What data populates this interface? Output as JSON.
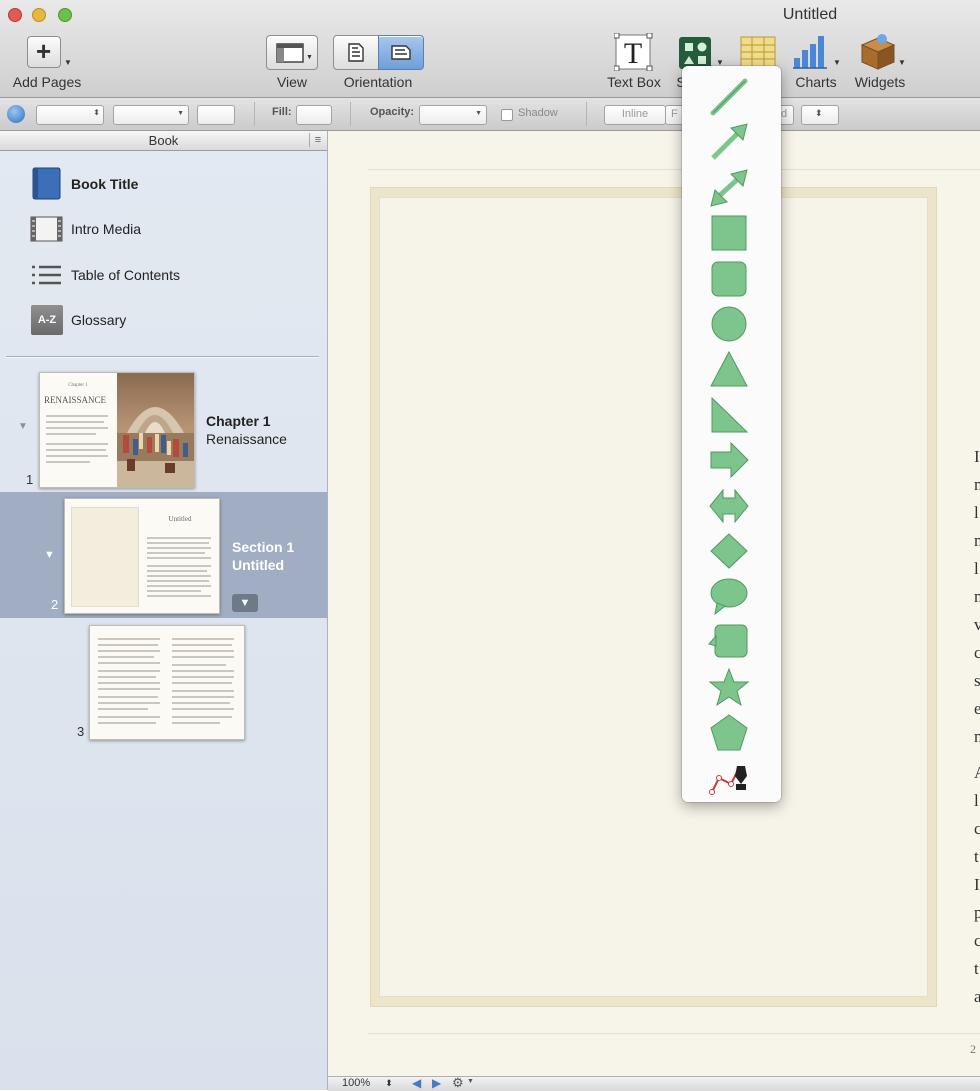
{
  "window": {
    "title": "Untitled"
  },
  "toolbar": {
    "add_pages": "Add Pages",
    "view": "View",
    "orientation": "Orientation",
    "text_box": "Text Box",
    "shapes": "S",
    "charts": "Charts",
    "widgets": "Widgets"
  },
  "format_bar": {
    "fill": "Fill:",
    "opacity": "Opacity:",
    "shadow": "Shadow",
    "inline": "Inline",
    "floating": "F",
    "anchored": "d"
  },
  "sidebar": {
    "header": "Book",
    "items": [
      {
        "label": "Book Title",
        "icon": "book-icon"
      },
      {
        "label": "Intro Media",
        "icon": "film-icon"
      },
      {
        "label": "Table of Contents",
        "icon": "list-icon"
      },
      {
        "label": "Glossary",
        "icon": "glossary-icon",
        "badge": "A-Z"
      }
    ],
    "chapter": {
      "title": "Chapter 1",
      "subtitle": "Renaissance",
      "page": "1",
      "thumb_heading": "RENAISSANCE",
      "thumb_small": "Chapter 1"
    },
    "section": {
      "title": "Section 1",
      "subtitle": "Untitled",
      "page": "2",
      "thumb_title": "Untitled"
    },
    "page3": {
      "page": "3"
    }
  },
  "status": {
    "zoom": "100%"
  },
  "canvas": {
    "page_number_fragment": "2",
    "right_text_fragment": [
      "I",
      "n",
      "l",
      "n",
      "l",
      "n",
      "v",
      "c",
      "s",
      "e",
      "n",
      "A",
      "l",
      "c",
      "t",
      "I",
      "p",
      "c",
      "t",
      "a"
    ]
  },
  "shapes_menu": {
    "items": [
      "line",
      "arrow",
      "double-arrow",
      "square",
      "rounded-square",
      "circle",
      "triangle",
      "right-triangle",
      "arrow-right",
      "double-arrow-shape",
      "diamond",
      "speech-bubble",
      "callout",
      "star",
      "pentagon",
      "pen-tool"
    ],
    "fill_color": "#7dc58c",
    "stroke_color": "#4f9a5e"
  }
}
